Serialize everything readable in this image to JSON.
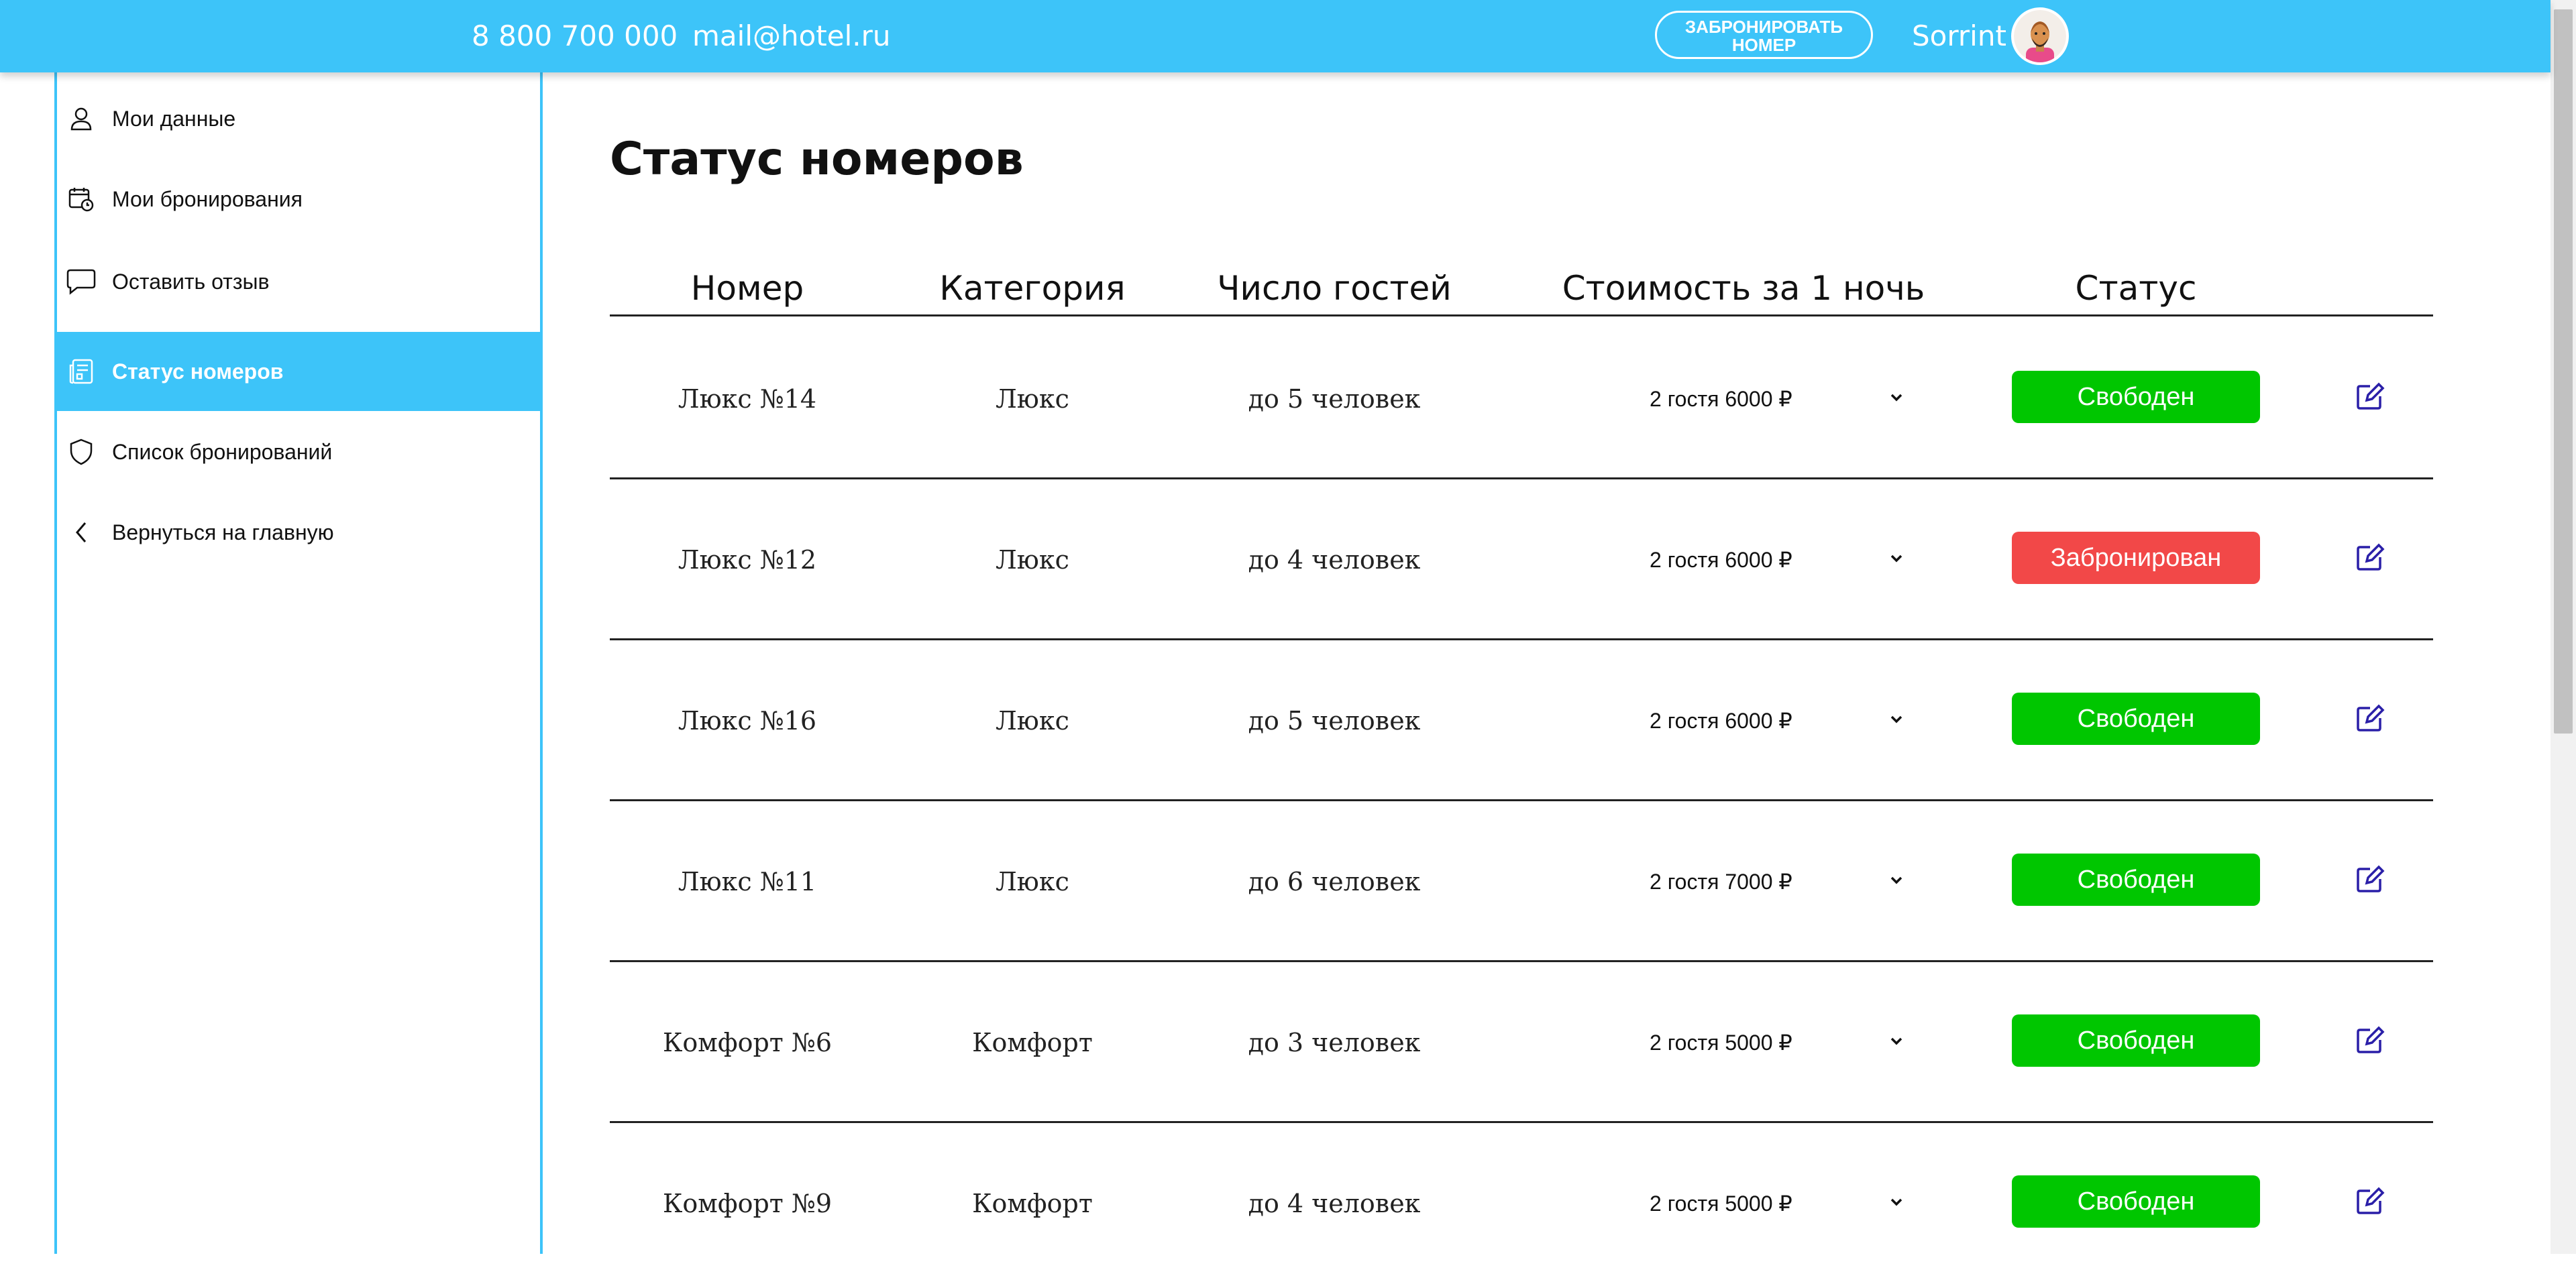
{
  "header": {
    "phone": "8 800 700 000",
    "email": "mail@hotel.ru",
    "book_button_line1": "ЗАБРОНИРОВАТЬ",
    "book_button_line2": "НОМЕР",
    "username": "Sorrint"
  },
  "sidebar": {
    "items": [
      {
        "label": "Мои данные",
        "icon": "user-icon"
      },
      {
        "label": "Мои бронирования",
        "icon": "calendar-clock-icon"
      },
      {
        "label": "Оставить отзыв",
        "icon": "chat-bubble-icon"
      },
      {
        "label": "Статус номеров",
        "icon": "document-list-icon",
        "active": true
      },
      {
        "label": "Список бронирований",
        "icon": "shield-icon"
      },
      {
        "label": "Вернуться на главную",
        "icon": "chevron-left-icon"
      }
    ]
  },
  "main": {
    "title": "Статус номеров",
    "columns": [
      "Номер",
      "Категория",
      "Число гостей",
      "Стоимость за 1 ночь",
      "Статус"
    ],
    "rows": [
      {
        "room": "Люкс №14",
        "category": "Люкс",
        "guests": "до 5 человек",
        "price": "2 гостя 6000 ₽",
        "status": "Свободен",
        "status_color": "#00c600"
      },
      {
        "room": "Люкс №12",
        "category": "Люкс",
        "guests": "до 4 человек",
        "price": "2 гостя 6000 ₽",
        "status": "Забронирован",
        "status_color": "#f24848"
      },
      {
        "room": "Люкс №16",
        "category": "Люкс",
        "guests": "до 5 человек",
        "price": "2 гостя 6000 ₽",
        "status": "Свободен",
        "status_color": "#00c600"
      },
      {
        "room": "Люкс №11",
        "category": "Люкс",
        "guests": "до 6 человек",
        "price": "2 гостя 7000 ₽",
        "status": "Свободен",
        "status_color": "#00c600"
      },
      {
        "room": "Комфорт №6",
        "category": "Комфорт",
        "guests": "до 3 человек",
        "price": "2 гостя 5000 ₽",
        "status": "Свободен",
        "status_color": "#00c600"
      },
      {
        "room": "Комфорт №9",
        "category": "Комфорт",
        "guests": "до 4 человек",
        "price": "2 гостя 5000 ₽",
        "status": "Свободен",
        "status_color": "#00c600"
      }
    ]
  },
  "colors": {
    "accent": "#3dc4f9",
    "free": "#00c600",
    "booked": "#f24848",
    "edit_icon": "#2a1fa8"
  }
}
